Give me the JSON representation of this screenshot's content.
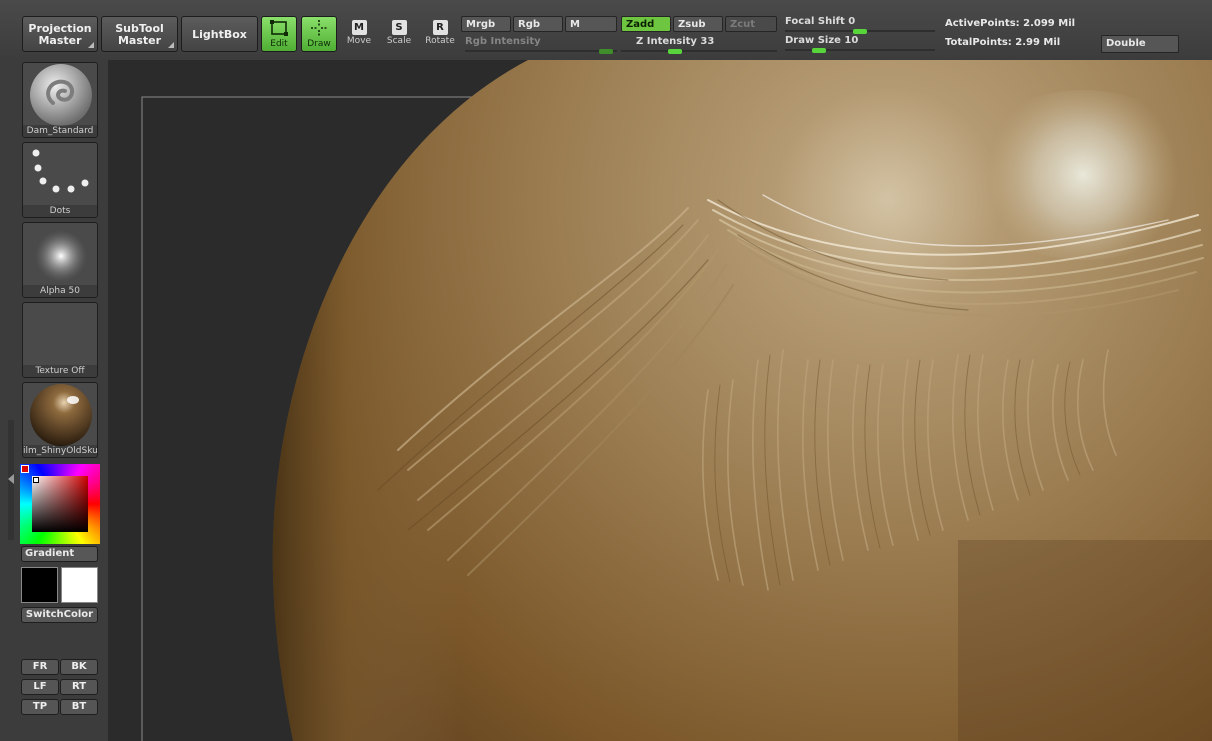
{
  "toolbar": {
    "projection_master": "Projection\nMaster",
    "subtool_master": "SubTool\nMaster",
    "lightbox": "LightBox",
    "edit": "Edit",
    "draw": "Draw",
    "move": "Move",
    "scale": "Scale",
    "rotate": "Rotate",
    "move_key": "M",
    "scale_key": "S",
    "rotate_key": "R",
    "mrgb": "Mrgb",
    "rgb": "Rgb",
    "m": "M",
    "zadd": "Zadd",
    "zsub": "Zsub",
    "zcut": "Zcut",
    "rgb_intensity": "Rgb Intensity",
    "z_intensity_label": "Z Intensity",
    "z_intensity_value": "33",
    "focal_shift_label": "Focal Shift",
    "focal_shift_value": "0",
    "draw_size_label": "Draw Size",
    "draw_size_value": "10",
    "active_points": "ActivePoints: 2.099 Mil",
    "total_points": "TotalPoints: 2.99 Mil",
    "double": "Double"
  },
  "sliders": {
    "rgb_intensity_level": 0.97,
    "z_intensity_level": 0.33,
    "focal_shift_level": 0.5,
    "draw_size_level": 0.2
  },
  "left_panel": {
    "brush": "Dam_Standard",
    "stroke": "Dots",
    "alpha": "Alpha 50",
    "texture": "Texture Off",
    "material": "ilm_ShinyOldSkul",
    "gradient": "Gradient",
    "switch_color": "SwitchColor",
    "view_buttons": [
      "FR",
      "BK",
      "LF",
      "RT",
      "TP",
      "BT"
    ]
  },
  "colors": {
    "accent_green": "#6ec640",
    "primary_color": "#000000",
    "secondary_color": "#ffffff",
    "clay": "#9a7a4e"
  }
}
